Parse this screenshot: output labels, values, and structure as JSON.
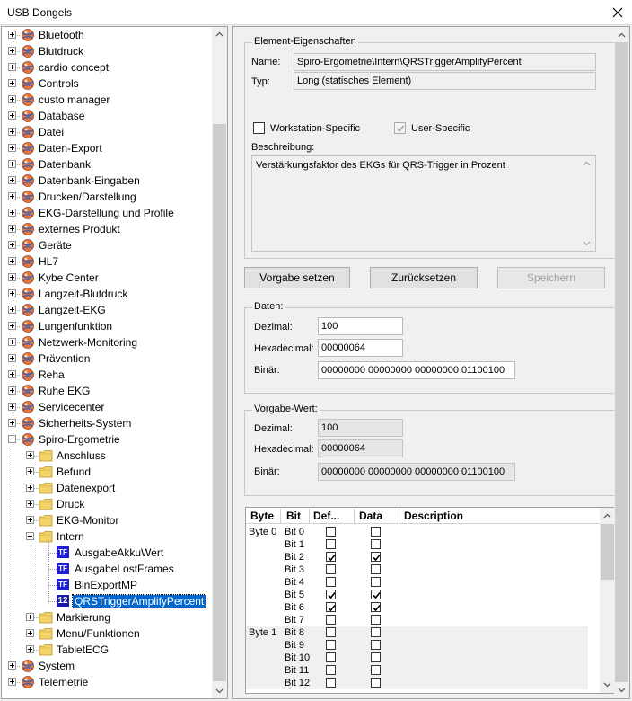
{
  "window": {
    "title": "USB Dongels"
  },
  "tree": {
    "top_items": [
      "Bluetooth",
      "Blutdruck",
      "cardio concept",
      "Controls",
      "custo manager",
      "Database",
      "Datei",
      "Daten-Export",
      "Datenbank",
      "Datenbank-Eingaben",
      "Drucken/Darstellung",
      "EKG-Darstellung und Profile",
      "externes Produkt",
      "Geräte",
      "HL7",
      "Kybe Center",
      "Langzeit-Blutdruck",
      "Langzeit-EKG",
      "Lungenfunktion",
      "Netzwerk-Monitoring",
      "Prävention",
      "Reha",
      "Ruhe EKG",
      "Servicecenter",
      "Sicherheits-System"
    ],
    "expanded_item": "Spiro-Ergometrie",
    "children_before": [
      "Anschluss",
      "Befund",
      "Datenexport",
      "Druck",
      "EKG-Monitor"
    ],
    "expanded_child": "Intern",
    "leaves": [
      {
        "badge": "TF",
        "label": "AusgabeAkkuWert"
      },
      {
        "badge": "TF",
        "label": "AusgabeLostFrames"
      },
      {
        "badge": "TF",
        "label": "BinExportMP"
      },
      {
        "badge": "12",
        "label": "QRSTriggerAmplifyPercent"
      }
    ],
    "children_after": [
      "Markierung",
      "Menu/Funktionen",
      "TabletECG"
    ],
    "bottom_items": [
      "System",
      "Telemetrie"
    ]
  },
  "properties": {
    "legend": "Element-Eigenschaften",
    "name_label": "Name:",
    "name_value": "Spiro-Ergometrie\\Intern\\QRSTriggerAmplifyPercent",
    "type_label": "Typ:",
    "type_value": "Long (statisches Element)",
    "workstation_label": "Workstation-Specific",
    "user_label": "User-Specific",
    "description_label": "Beschreibung:",
    "description_value": "Verstärkungsfaktor des EKGs für QRS-Trigger in Prozent"
  },
  "buttons": {
    "default": "Vorgabe setzen",
    "reset": "Zurücksetzen",
    "save": "Speichern"
  },
  "daten": {
    "legend": "Daten:",
    "decimal_label": "Dezimal:",
    "decimal_value": "100",
    "hex_label": "Hexadecimal:",
    "hex_value": "00000064",
    "bin_label": "Binär:",
    "bin_value": "00000000 00000000 00000000 01100100"
  },
  "vorgabe": {
    "legend": "Vorgabe-Wert:",
    "decimal_label": "Dezimal:",
    "decimal_value": "100",
    "hex_label": "Hexadecimal:",
    "hex_value": "00000064",
    "bin_label": "Binär:",
    "bin_value": "00000000 00000000 00000000 01100100"
  },
  "grid": {
    "columns": [
      "Byte",
      "Bit",
      "Def...",
      "Data",
      "Description"
    ],
    "rows": [
      {
        "byte": "Byte 0",
        "bit": "Bit 0",
        "def": false,
        "data": false
      },
      {
        "byte": "",
        "bit": "Bit 1",
        "def": false,
        "data": false
      },
      {
        "byte": "",
        "bit": "Bit 2",
        "def": true,
        "data": true
      },
      {
        "byte": "",
        "bit": "Bit 3",
        "def": false,
        "data": false
      },
      {
        "byte": "",
        "bit": "Bit 4",
        "def": false,
        "data": false
      },
      {
        "byte": "",
        "bit": "Bit 5",
        "def": true,
        "data": true
      },
      {
        "byte": "",
        "bit": "Bit 6",
        "def": true,
        "data": true
      },
      {
        "byte": "",
        "bit": "Bit 7",
        "def": false,
        "data": false
      },
      {
        "byte": "Byte 1",
        "bit": "Bit 8",
        "def": false,
        "data": false
      },
      {
        "byte": "",
        "bit": "Bit 9",
        "def": false,
        "data": false
      },
      {
        "byte": "",
        "bit": "Bit 10",
        "def": false,
        "data": false
      },
      {
        "byte": "",
        "bit": "Bit 11",
        "def": false,
        "data": false
      },
      {
        "byte": "",
        "bit": "Bit 12",
        "def": false,
        "data": false
      }
    ]
  },
  "colors": {
    "selection": "#0066cc",
    "leaf_badge": "#1f1fd6"
  }
}
